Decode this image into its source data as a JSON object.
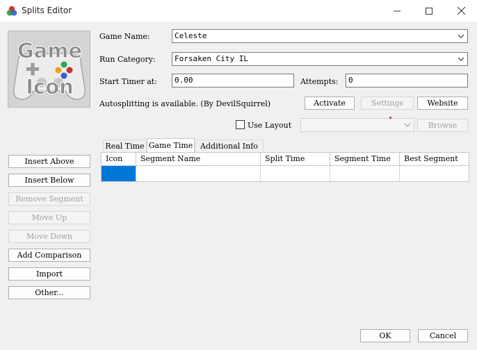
{
  "window": {
    "title": "Splits Editor"
  },
  "game_icon": {
    "line1": "Game",
    "line2": "Icon"
  },
  "game_name": {
    "label": "Game Name:",
    "value": "Celeste"
  },
  "run_category": {
    "label": "Run Category:",
    "value": "Forsaken City IL"
  },
  "start_timer": {
    "label": "Start Timer at:",
    "value": "0.00"
  },
  "attempts": {
    "label": "Attempts:",
    "value": "0"
  },
  "autosplit": {
    "text": "Autosplitting is available. (By DevilSquirrel)",
    "activate_label": "Activate",
    "settings_label": "Settings",
    "website_label": "Website"
  },
  "layout": {
    "use_layout_label": "Use Layout",
    "browse_label": "Browse",
    "checked": false
  },
  "tabs": [
    {
      "label": "Real Time",
      "active": false
    },
    {
      "label": "Game Time",
      "active": true
    },
    {
      "label": "Additional Info",
      "active": false
    }
  ],
  "grid": {
    "columns": [
      "Icon",
      "Segment Name",
      "Split Time",
      "Segment Time",
      "Best Segment"
    ]
  },
  "side_buttons": {
    "insert_above": "Insert Above",
    "insert_below": "Insert Below",
    "remove_segment": "Remove Segment",
    "move_up": "Move Up",
    "move_down": "Move Down",
    "add_comparison": "Add Comparison",
    "import": "Import",
    "other": "Other..."
  },
  "footer": {
    "ok_label": "OK",
    "cancel_label": "Cancel"
  },
  "colors": {
    "selection": "#0078d7",
    "window_bg": "#f0f0f0"
  }
}
